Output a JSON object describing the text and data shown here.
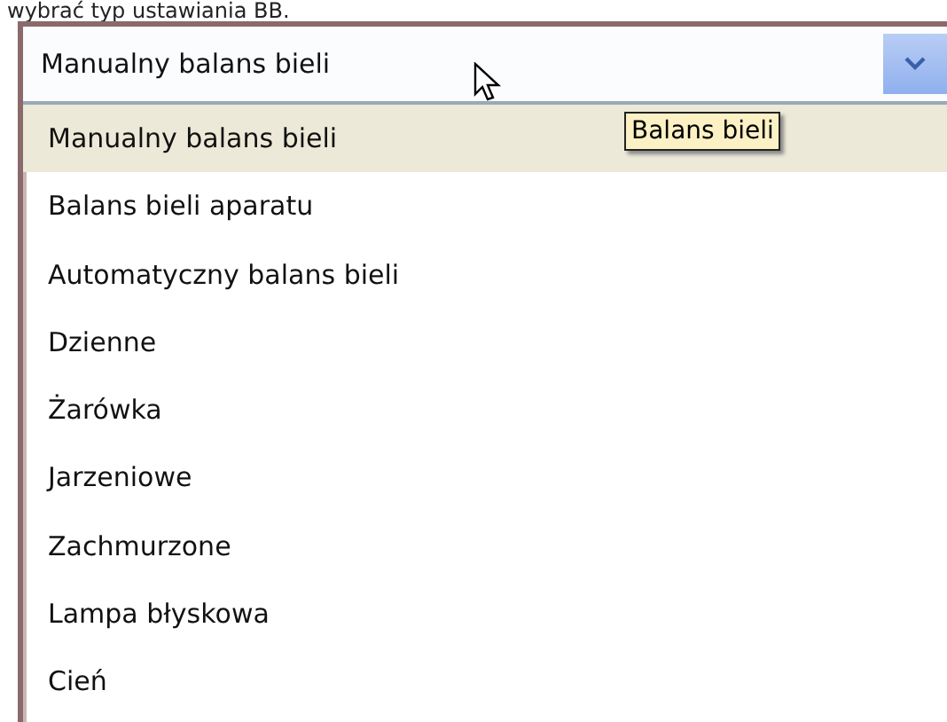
{
  "caption": "wybrać typ ustawiania BB.",
  "combo": {
    "value": "Manualny balans bieli"
  },
  "tooltip": "Balans bieli",
  "options": [
    {
      "label": "Manualny balans bieli",
      "selected": true
    },
    {
      "label": "Balans bieli aparatu",
      "selected": false
    },
    {
      "label": "Automatyczny balans bieli",
      "selected": false
    },
    {
      "label": "Dzienne",
      "selected": false
    },
    {
      "label": "Żarówka",
      "selected": false
    },
    {
      "label": "Jarzeniowe",
      "selected": false
    },
    {
      "label": "Zachmurzone",
      "selected": false
    },
    {
      "label": "Lampa błyskowa",
      "selected": false
    },
    {
      "label": "Cień",
      "selected": false
    }
  ]
}
